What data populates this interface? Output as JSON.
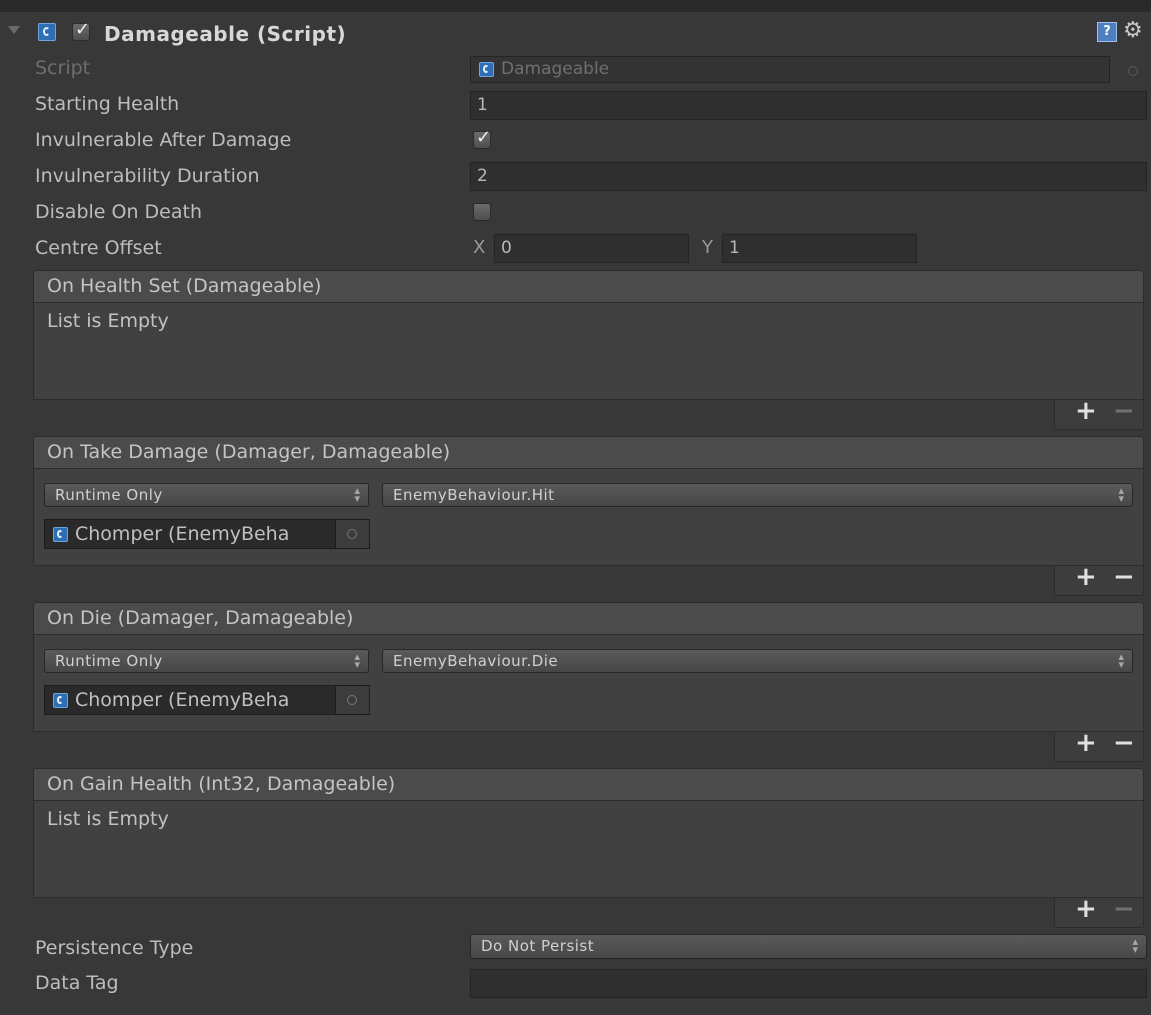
{
  "component": {
    "title": "Damageable (Script)",
    "enabled": true,
    "icons": [
      "fold-arrow-icon",
      "script-icon",
      "help-icon",
      "gear-icon"
    ]
  },
  "fields": {
    "script": {
      "label": "Script",
      "value": "Damageable"
    },
    "starting_health": {
      "label": "Starting Health",
      "value": "1"
    },
    "invulnerable_after_damage": {
      "label": "Invulnerable After Damage",
      "checked": true
    },
    "invulnerability_duration": {
      "label": "Invulnerability Duration",
      "value": "2"
    },
    "disable_on_death": {
      "label": "Disable On Death",
      "checked": false
    },
    "centre_offset": {
      "label": "Centre Offset",
      "x_label": "X",
      "x": "0",
      "y_label": "Y",
      "y": "1"
    },
    "persistence_type": {
      "label": "Persistence Type",
      "value": "Do Not Persist"
    },
    "data_tag": {
      "label": "Data Tag",
      "value": ""
    }
  },
  "events": {
    "on_health_set": {
      "title": "On Health Set (Damageable)",
      "empty_text": "List is Empty"
    },
    "on_take_damage": {
      "title": "On Take Damage (Damager, Damageable)",
      "mode": "Runtime Only",
      "function": "EnemyBehaviour.Hit",
      "target": "Chomper (EnemyBeha"
    },
    "on_die": {
      "title": "On Die (Damager, Damageable)",
      "mode": "Runtime Only",
      "function": "EnemyBehaviour.Die",
      "target": "Chomper (EnemyBeha"
    },
    "on_gain_health": {
      "title": "On Gain Health (Int32, Damageable)",
      "empty_text": "List is Empty"
    }
  },
  "list_controls": {
    "add": "+",
    "remove": "−"
  },
  "colors": {
    "background": "#383838",
    "field": "#2f2f2f",
    "header": "#4b4b4b",
    "accent_icon": "#2f6db5"
  }
}
